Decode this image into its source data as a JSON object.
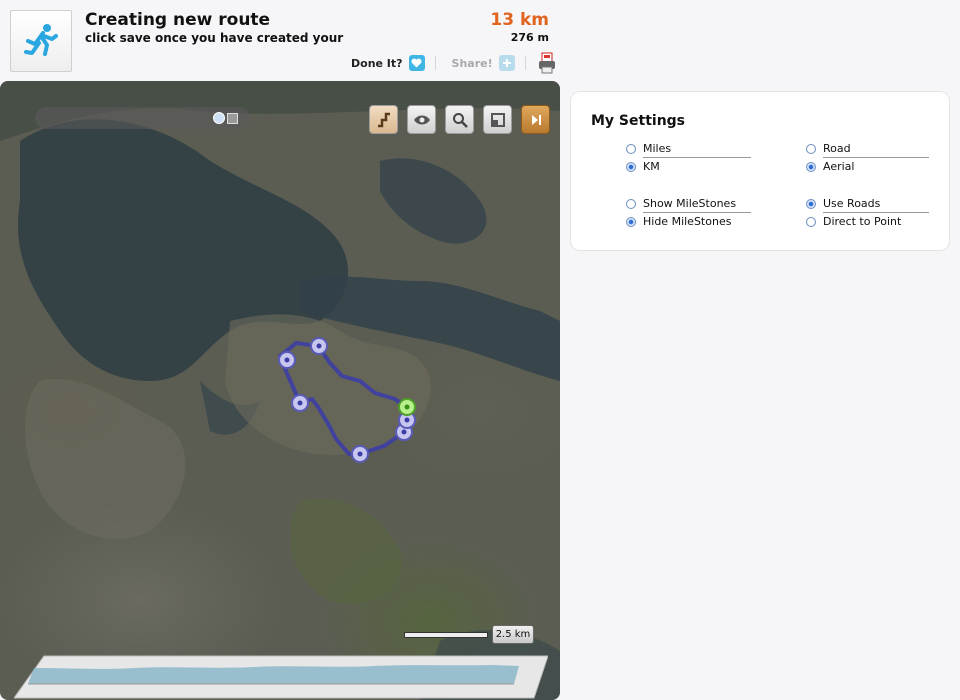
{
  "header": {
    "title": "Creating new route",
    "subtitle": "click save once you have created your",
    "distance_main": "13 km",
    "distance_sub": "276 m",
    "done_label": "Done It?",
    "share_label": "Share!",
    "icons": {
      "app": "runner-icon",
      "done": "heart-icon",
      "share": "plus-icon",
      "export": "pdf-print-icon"
    }
  },
  "map": {
    "scale_label": "2.5 km",
    "tools": [
      "route-mode-icon",
      "eye-icon",
      "search-icon",
      "fullscreen-icon",
      "next-icon"
    ],
    "route_color": "#3d3da6"
  },
  "settings": {
    "title": "My Settings",
    "groups": [
      {
        "options": [
          {
            "label": "Miles",
            "selected": false
          },
          {
            "label": "KM",
            "selected": true
          }
        ]
      },
      {
        "options": [
          {
            "label": "Road",
            "selected": false
          },
          {
            "label": "Aerial",
            "selected": true
          }
        ]
      },
      {
        "options": [
          {
            "label": "Show MileStones",
            "selected": false
          },
          {
            "label": "Hide MileStones",
            "selected": true
          }
        ]
      },
      {
        "options": [
          {
            "label": "Use Roads",
            "selected": true
          },
          {
            "label": "Direct to Point",
            "selected": false
          }
        ]
      }
    ]
  },
  "colors": {
    "accent_orange": "#e0641f",
    "share_blue": "#3fb6e4"
  }
}
